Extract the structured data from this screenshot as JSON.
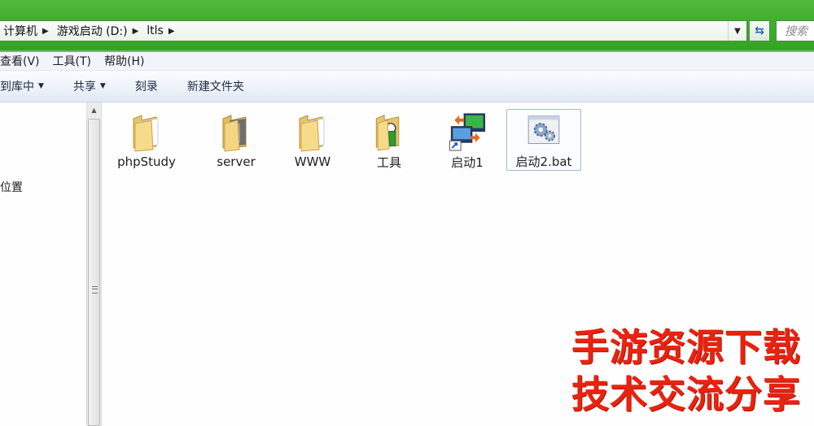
{
  "address": {
    "crumbs": [
      "计算机",
      "游戏启动 (D:)",
      "ltls"
    ],
    "search_placeholder": "搜索"
  },
  "menu": [
    "查看(V)",
    "工具(T)",
    "帮助(H)"
  ],
  "commands": {
    "include_library": "到库中",
    "share": "共享",
    "burn": "刻录",
    "new_folder": "新建文件夹"
  },
  "nav": {
    "item": "位置"
  },
  "files": [
    {
      "name": "phpStudy",
      "type": "folder",
      "icon": "folder-icon"
    },
    {
      "name": "server",
      "type": "folder",
      "icon": "folder-icon"
    },
    {
      "name": "WWW",
      "type": "folder",
      "icon": "folder-icon"
    },
    {
      "name": "工具",
      "type": "folder",
      "icon": "folder-tools-icon"
    },
    {
      "name": "启动1",
      "type": "shortcut",
      "icon": "network-shortcut-icon"
    },
    {
      "name": "启动2.bat",
      "type": "batch",
      "icon": "gear-bat-icon",
      "selected": true
    }
  ],
  "watermark": {
    "line1": "手游资源下载",
    "line2": "技术交流分享"
  }
}
